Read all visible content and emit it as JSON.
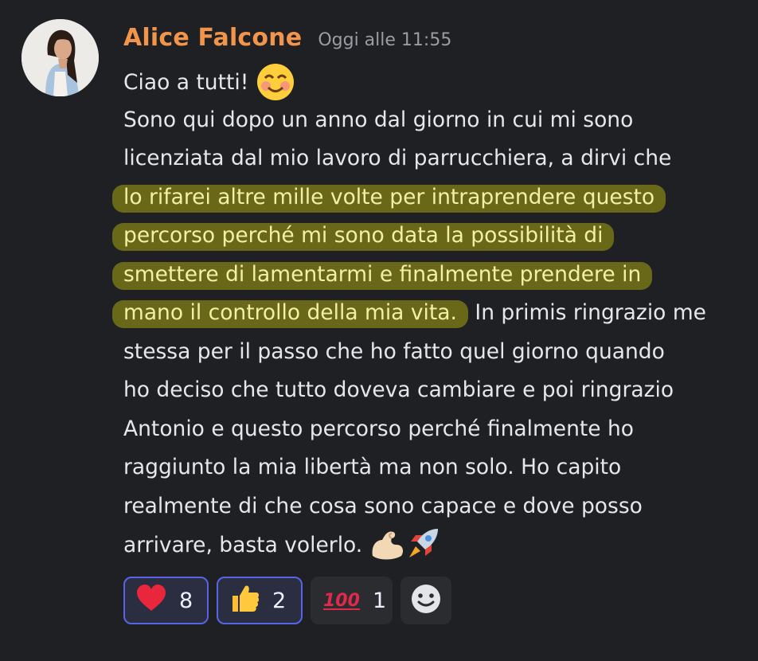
{
  "message": {
    "author": "Alice Falcone",
    "timestamp": "Oggi alle 11:55",
    "lines": [
      {
        "text": "Ciao a tutti! ",
        "emoji": "smiling-blush-emoji"
      },
      {
        "text": "Sono qui dopo un anno dal giorno in cui mi sono"
      },
      {
        "text": "licenziata dal mio lavoro di parrucchiera, a dirvi che"
      },
      {
        "highlight": "lo rifarei altre mille volte per intraprendere questo"
      },
      {
        "highlight": "percorso perché mi sono data la possibilità di"
      },
      {
        "highlight": "smettere di lamentarmi e finalmente prendere in"
      },
      {
        "highlight": "mano il controllo della mia vita.",
        "text": " In primis ringrazio me"
      },
      {
        "text": "stessa per il passo che ho fatto quel giorno quando"
      },
      {
        "text": "ho deciso che tutto doveva cambiare e poi ringrazio"
      },
      {
        "text": "Antonio e questo percorso perché finalmente ho"
      },
      {
        "text": "raggiunto la mia libertà ma non solo. Ho capito"
      },
      {
        "text": "realmente di che cosa sono capace e dove posso"
      },
      {
        "text": "arrivare, basta volerlo. ",
        "emoji": "flexed-biceps-emoji rocket-emoji"
      }
    ]
  },
  "reactions": [
    {
      "icon": "red-heart-icon",
      "count": "8",
      "selected": true
    },
    {
      "icon": "thumbs-up-icon",
      "count": "2",
      "selected": true
    },
    {
      "icon": "hundred-points-icon",
      "glyph": "100",
      "count": "1",
      "selected": false
    }
  ],
  "add_reaction": {
    "icon": "add-reaction-smiley-icon"
  },
  "colors": {
    "background": "#1f2024",
    "username": "#f2954a",
    "timestamp": "#9a9ca3",
    "highlight": "#7a7816",
    "reaction_selected_border": "#5864e8"
  }
}
